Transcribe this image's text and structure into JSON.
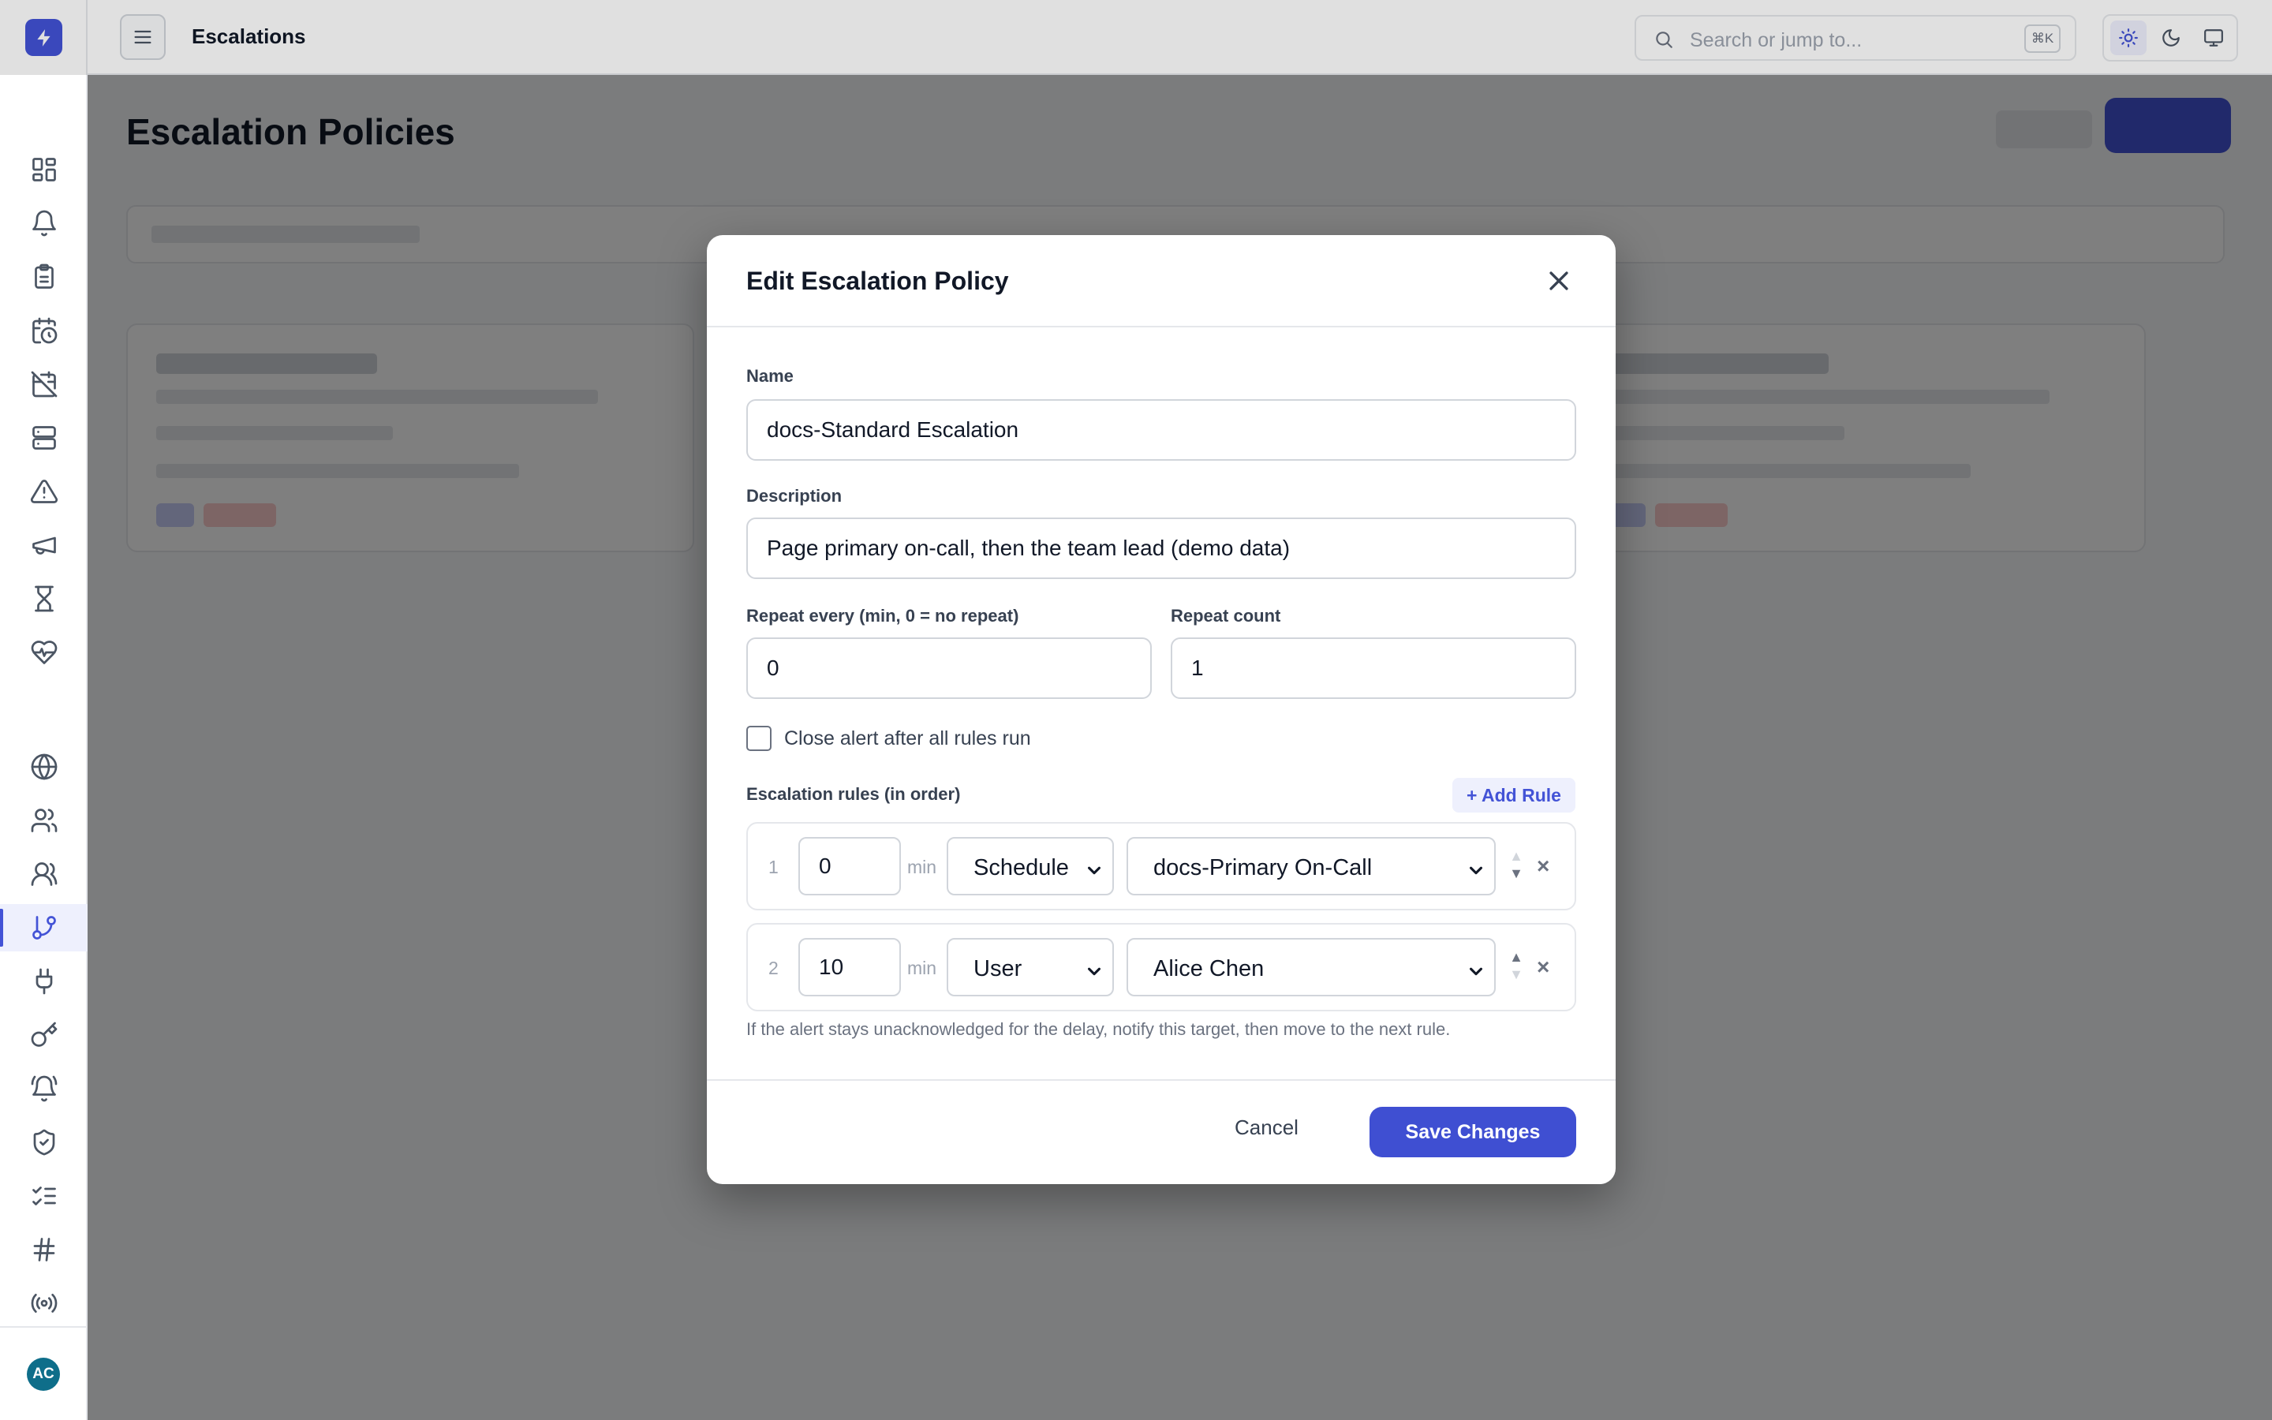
{
  "topbar": {
    "page_title": "Escalations",
    "search_placeholder": "Search or jump to...",
    "search_shortcut": "⌘K"
  },
  "sidebar": {
    "avatar_initials": "AC",
    "active_item": "escalations"
  },
  "background": {
    "page_title": "Escalation Policies"
  },
  "modal": {
    "title": "Edit Escalation Policy",
    "name_label": "Name",
    "name_value": "docs-Standard Escalation",
    "description_label": "Description",
    "description_value": "Page primary on-call, then the team lead (demo data)",
    "repeat_every_label": "Repeat every (min, 0 = no repeat)",
    "repeat_every_value": "0",
    "repeat_count_label": "Repeat count",
    "repeat_count_value": "1",
    "close_after_label": "Close alert after all rules run",
    "close_after_checked": false,
    "rules_title": "Escalation rules (in order)",
    "add_rule_label": "+ Add Rule",
    "min_unit": "min",
    "rules": [
      {
        "index": "1",
        "delay": "0",
        "target_type": "Schedule",
        "target": "docs-Primary On-Call"
      },
      {
        "index": "2",
        "delay": "10",
        "target_type": "User",
        "target": "Alice Chen"
      }
    ],
    "hint": "If the alert stays unacknowledged for the delay, notify this target, then move to the next rule.",
    "cancel_label": "Cancel",
    "save_label": "Save Changes"
  },
  "colors": {
    "accent": "#4353d6",
    "overlay": "rgba(0,0,0,0.50)",
    "avatar": "#0e6e8a"
  }
}
